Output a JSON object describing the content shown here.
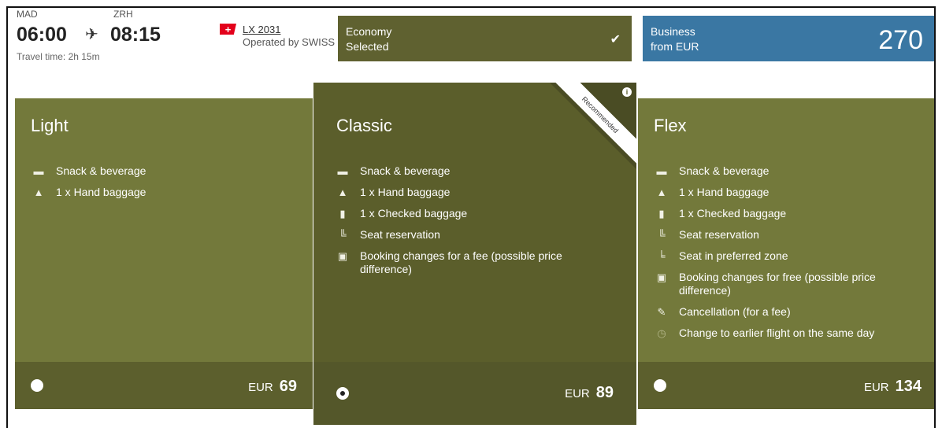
{
  "flight": {
    "origin": "MAD",
    "destination": "ZRH",
    "departure": "06:00",
    "arrival": "08:15",
    "travel_time": "Travel time: 2h 15m",
    "flight_number": "LX 2031",
    "operated_by": "Operated by SWISS"
  },
  "cabins": {
    "economy": {
      "name": "Economy",
      "status": "Selected"
    },
    "business": {
      "name": "Business",
      "from_label": "from EUR",
      "price": "270"
    }
  },
  "fares": [
    {
      "name": "Light",
      "currency": "EUR",
      "price": "69",
      "selected": false,
      "features": [
        {
          "icon": "meal-icon",
          "label": "Snack & beverage"
        },
        {
          "icon": "hand-baggage-icon",
          "label": "1 x Hand baggage"
        }
      ]
    },
    {
      "name": "Classic",
      "currency": "EUR",
      "price": "89",
      "selected": true,
      "badge": "Recommended",
      "features": [
        {
          "icon": "meal-icon",
          "label": "Snack & beverage"
        },
        {
          "icon": "hand-baggage-icon",
          "label": "1 x Hand baggage"
        },
        {
          "icon": "checked-baggage-icon",
          "label": "1 x Checked baggage"
        },
        {
          "icon": "seat-icon",
          "label": "Seat reservation"
        },
        {
          "icon": "calendar-icon",
          "label": "Booking changes for a fee (possible price difference)"
        }
      ]
    },
    {
      "name": "Flex",
      "currency": "EUR",
      "price": "134",
      "selected": false,
      "features": [
        {
          "icon": "meal-icon",
          "label": "Snack & beverage"
        },
        {
          "icon": "hand-baggage-icon",
          "label": "1 x Hand baggage"
        },
        {
          "icon": "checked-baggage-icon",
          "label": "1 x Checked baggage"
        },
        {
          "icon": "seat-icon",
          "label": "Seat reservation"
        },
        {
          "icon": "preferred-seat-icon",
          "label": "Seat in preferred zone"
        },
        {
          "icon": "calendar-icon",
          "label": "Booking changes for free (possible price difference)"
        },
        {
          "icon": "cancellation-icon",
          "label": "Cancellation (for a fee)"
        },
        {
          "icon": "clock-icon",
          "label": "Change to earlier flight on the same day"
        }
      ]
    }
  ],
  "colors": {
    "economy": "#5f6130",
    "business": "#3a77a3",
    "card": "#73793b",
    "card_selected": "#5b5e2b"
  }
}
